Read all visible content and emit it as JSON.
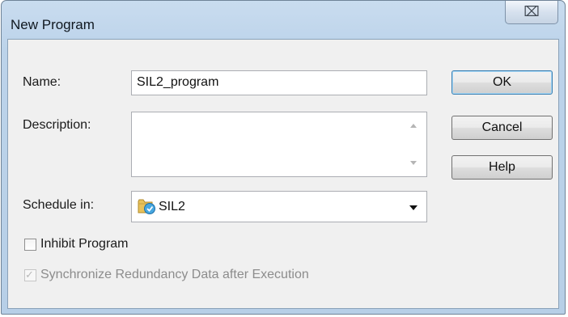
{
  "window": {
    "title": "New Program",
    "close_glyph": "⌧"
  },
  "form": {
    "name_label": "Name:",
    "name_value": "SIL2_program",
    "description_label": "Description:",
    "description_value": "",
    "schedule_label": "Schedule in:",
    "schedule_value": "SIL2",
    "schedule_icon": "folder-with-task-icon"
  },
  "buttons": {
    "ok": "OK",
    "cancel": "Cancel",
    "help": "Help"
  },
  "options": {
    "inhibit_label": "Inhibit Program",
    "inhibit_checked": false,
    "sync_label": "Synchronize Redundancy Data after Execution",
    "sync_checked": true,
    "sync_enabled": false,
    "check_glyph": "✓"
  }
}
